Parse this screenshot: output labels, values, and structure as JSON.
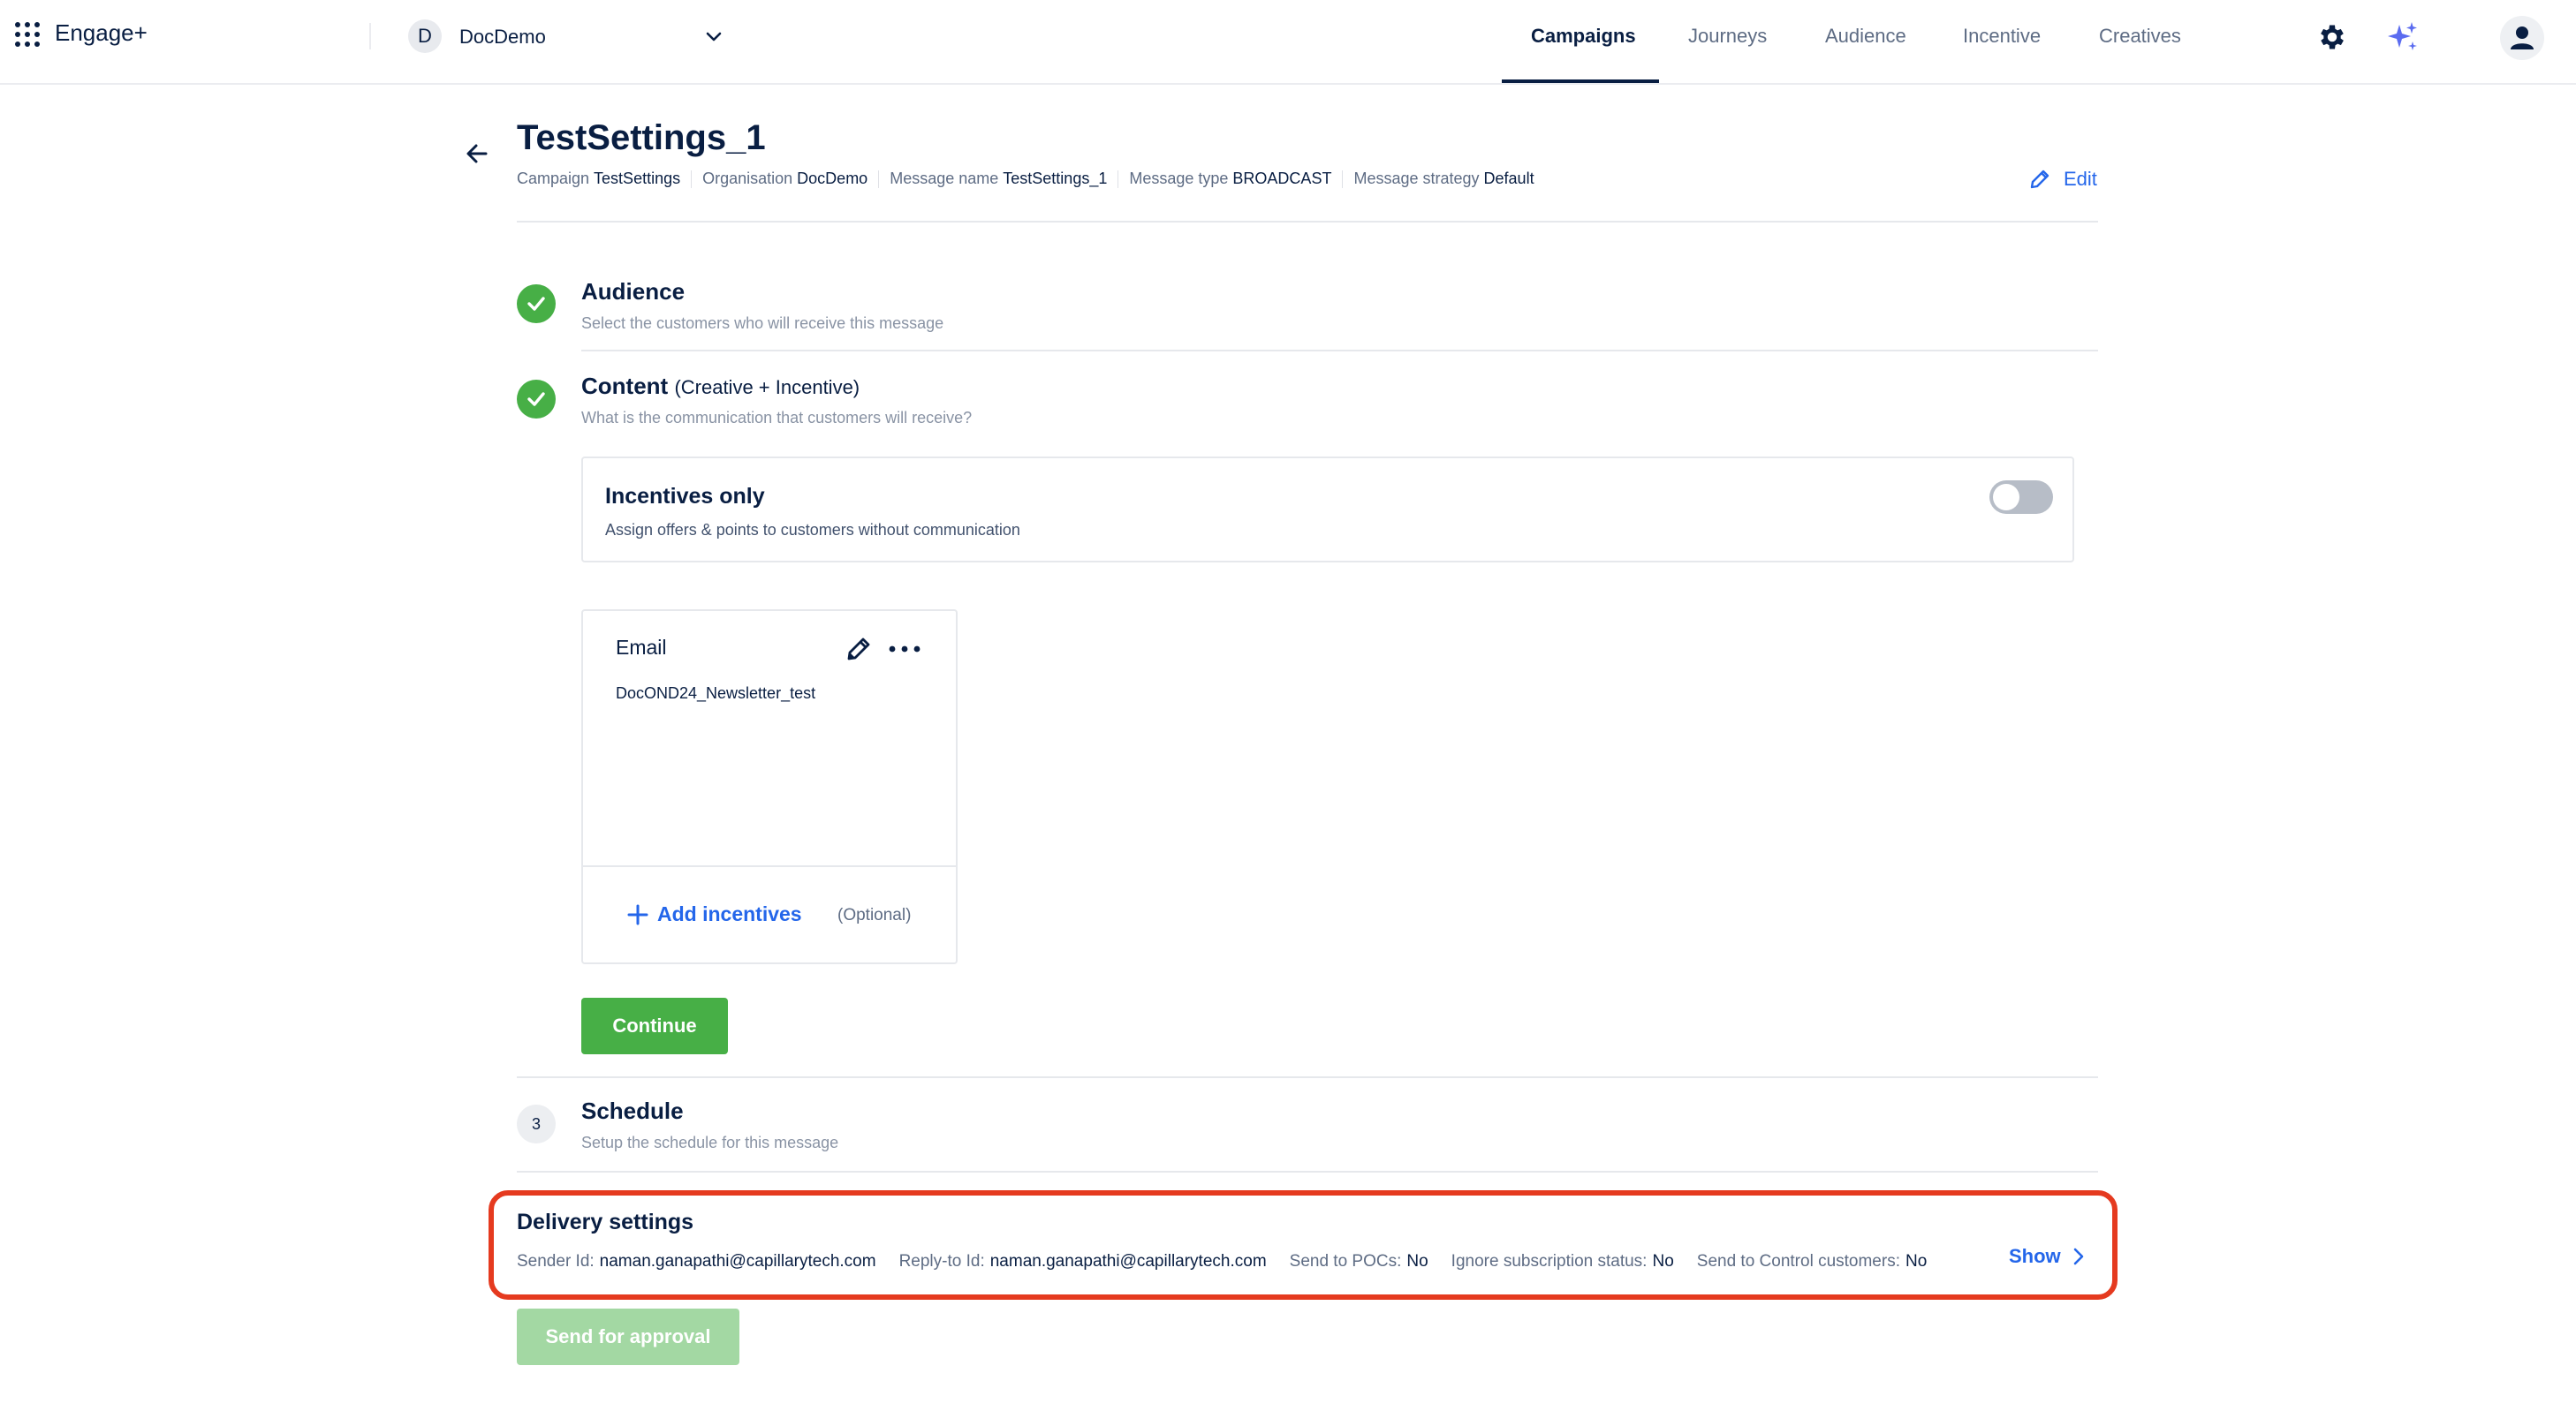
{
  "app": {
    "name": "Engage+"
  },
  "org": {
    "initial": "D",
    "name": "DocDemo"
  },
  "nav": {
    "items": [
      {
        "label": "Campaigns",
        "active": true
      },
      {
        "label": "Journeys"
      },
      {
        "label": "Audience"
      },
      {
        "label": "Incentive"
      },
      {
        "label": "Creatives"
      }
    ]
  },
  "header": {
    "title": "TestSettings_1",
    "meta": [
      {
        "key": "Campaign",
        "value": "TestSettings"
      },
      {
        "key": "Organisation",
        "value": "DocDemo"
      },
      {
        "key": "Message name",
        "value": "TestSettings_1"
      },
      {
        "key": "Message type",
        "value": "BROADCAST"
      },
      {
        "key": "Message strategy",
        "value": "Default"
      }
    ],
    "edit_label": "Edit"
  },
  "steps": {
    "audience": {
      "title": "Audience",
      "subtitle": "Select the customers who will receive this message"
    },
    "content": {
      "title": "Content",
      "extra": "(Creative + Incentive)",
      "subtitle": "What is the communication that customers will receive?"
    },
    "schedule": {
      "number": "3",
      "title": "Schedule",
      "subtitle": "Setup the schedule for this message"
    }
  },
  "incentives_only": {
    "title": "Incentives only",
    "subtitle": "Assign offers & points to customers without communication",
    "enabled": false
  },
  "email_card": {
    "title": "Email",
    "creative_name": "DocOND24_Newsletter_test",
    "add_incentives": "Add incentives",
    "optional": "(Optional)"
  },
  "continue_label": "Continue",
  "delivery": {
    "title": "Delivery settings",
    "items": [
      {
        "key": "Sender Id:",
        "value": "naman.ganapathi@capillarytech.com"
      },
      {
        "key": "Reply-to Id:",
        "value": "naman.ganapathi@capillarytech.com"
      },
      {
        "key": "Send to POCs:",
        "value": "No"
      },
      {
        "key": "Ignore subscription status:",
        "value": "No"
      },
      {
        "key": "Send to Control customers:",
        "value": "No"
      }
    ],
    "show_label": "Show",
    "highlight_color": "#e53a1f"
  },
  "approval_label": "Send for approval",
  "colors": {
    "accent": "#2466ea",
    "success": "#47af46",
    "text": "#091e42"
  }
}
